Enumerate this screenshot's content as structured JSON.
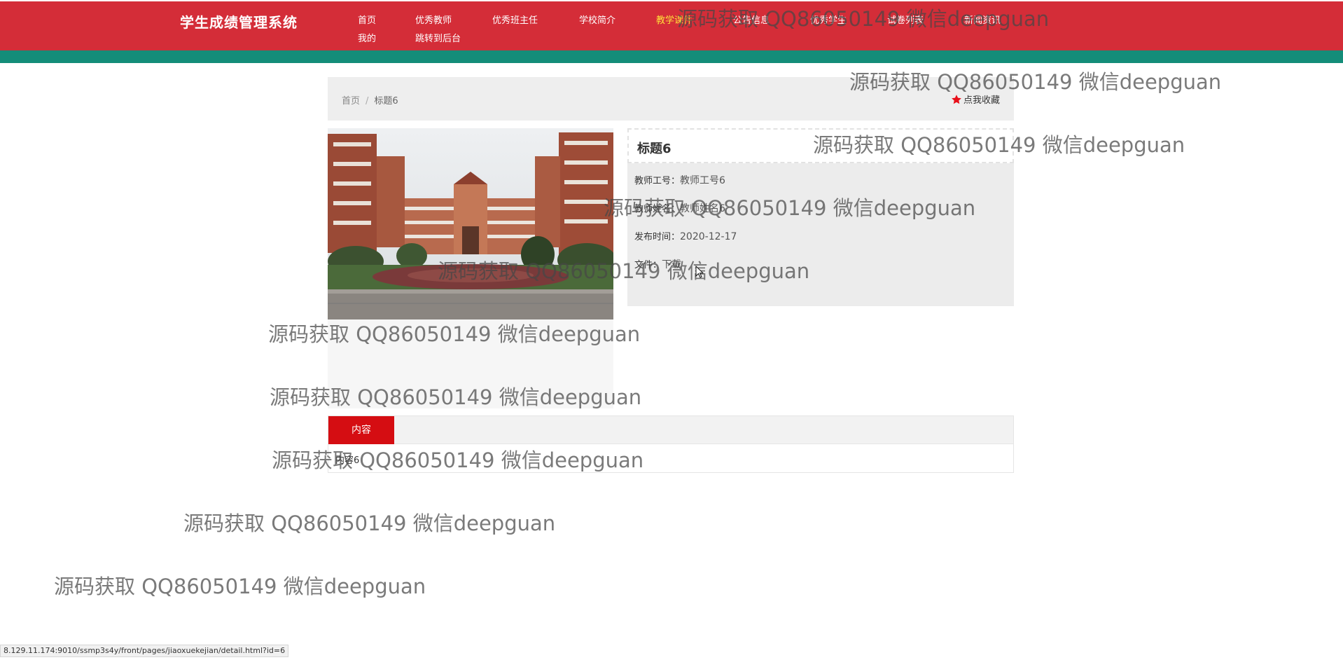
{
  "header": {
    "logo": "学生成绩管理系统",
    "nav": [
      {
        "label": "首页",
        "active": false
      },
      {
        "label": "优秀教师",
        "active": false
      },
      {
        "label": "优秀班主任",
        "active": false
      },
      {
        "label": "学校简介",
        "active": false
      },
      {
        "label": "教学课件",
        "active": true
      },
      {
        "label": "公告信息",
        "active": false
      },
      {
        "label": "优秀学生",
        "active": false
      },
      {
        "label": "试卷列表",
        "active": false
      },
      {
        "label": "新闻资讯",
        "active": false
      },
      {
        "label": "我的",
        "active": false
      },
      {
        "label": "跳转到后台",
        "active": false
      }
    ]
  },
  "breadcrumb": {
    "home": "首页",
    "separator": "/",
    "current": "标题6"
  },
  "favorite": {
    "icon": "star-icon",
    "label": "点我收藏"
  },
  "detail": {
    "title": "标题6",
    "fields": [
      {
        "key": "教师工号：",
        "value": "教师工号6"
      },
      {
        "key": "教师姓名：",
        "value": "教师姓名6"
      },
      {
        "key": "发布时间：",
        "value": "2020-12-17"
      },
      {
        "key": "文件：",
        "value": "下载"
      }
    ]
  },
  "content_tab": {
    "label": "内容",
    "body": "内容6"
  },
  "watermark": "源码获取 QQ86050149 微信deepguan",
  "status_url": "8.129.11.174:9010/ssmp3s4y/front/pages/jiaoxuekejian/detail.html?id=6",
  "colors": {
    "header": "#d42d38",
    "stripe": "#148d79",
    "tab_active": "#d50d12",
    "nav_active": "#ffe13a"
  }
}
